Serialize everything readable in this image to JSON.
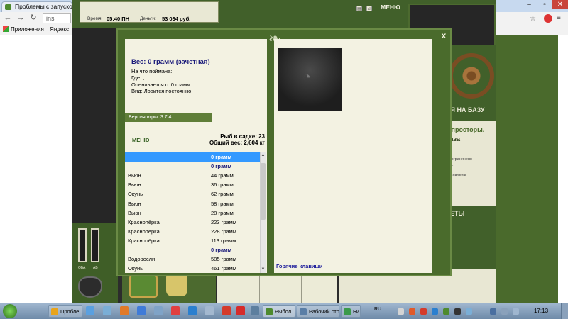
{
  "browser": {
    "tab_title": "Проблемы с запуском",
    "address_partial": "ins",
    "bookmarks": [
      "Приложения",
      "Яндекс"
    ]
  },
  "game": {
    "time_label": "Время:",
    "time_value": "05:40 ПН",
    "money_label": "Деньги:",
    "money_value": "53 034 руб.",
    "menu_top": "МЕНЮ",
    "right_heading1": "СЯ НА БАЗУ",
    "right_text": "е просторы.",
    "right_text2": "база",
    "right_small1": "не ограничено",
    "right_small2": "руб.",
    "right_small3": "объявлены",
    "right_heading2": "РЕТЫ",
    "gauge_labels": [
      "ОБА",
      "АБ"
    ]
  },
  "modal": {
    "close": "x",
    "fish_title": "Вес: 0 грамм (зачетная)",
    "caught_on": "На что поймана:",
    "where": "Где: ,",
    "valued_from": "Оценивается с: 0 грамм",
    "view": "Вид: Ловится постоянно",
    "version": "Версия игры: 3.7.4",
    "menu": "МЕНЮ",
    "fish_in_keepnet": "Рыб в садке: 23",
    "total_weight": "Общий вес: 2,604 кг",
    "hotkeys": "Горячие клавиши",
    "rows": [
      {
        "name": "",
        "weight": "0 грамм",
        "selected": true
      },
      {
        "name": "",
        "weight": "0 грамм",
        "header": true
      },
      {
        "name": "Вьюн",
        "weight": "44 грамм"
      },
      {
        "name": "Вьюн",
        "weight": "36 грамм"
      },
      {
        "name": "Окунь",
        "weight": "62 грамм"
      },
      {
        "name": "Вьюн",
        "weight": "58 грамм"
      },
      {
        "name": "Вьюн",
        "weight": "28 грамм"
      },
      {
        "name": "Краснопёрка",
        "weight": "223 грамм"
      },
      {
        "name": "Краснопёрка",
        "weight": "228 грамм"
      },
      {
        "name": "Краснопёрка",
        "weight": "113 грамм"
      },
      {
        "name": "",
        "weight": "0 грамм",
        "header": true
      },
      {
        "name": "Водоросли",
        "weight": "585 грамм"
      },
      {
        "name": "Окунь",
        "weight": "461 грамм"
      }
    ]
  },
  "taskbar": {
    "chrome_btn": "Пробле...",
    "game_btn": "Рыбол...",
    "desktop_btn": "Рабочий стол",
    "bi_btn": "Би",
    "lang": "RU",
    "clock": "17:13"
  },
  "colors": {
    "accent_green": "#4a6b2c",
    "cream": "#f3f2e2",
    "selection": "#3399ff",
    "title_blue": "#1a1a7a"
  }
}
